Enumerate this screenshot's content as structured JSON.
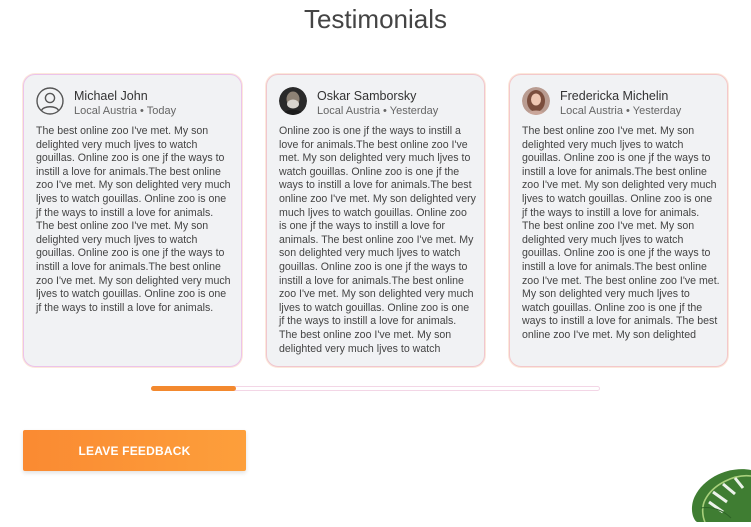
{
  "section": {
    "title": "Testimonials"
  },
  "testimonials": [
    {
      "name": "Michael John",
      "meta": "Local Austria • Today",
      "avatar": "user-outline-icon",
      "text": "The best online zoo I've met. My son delighted very much ljves to watch gouillas. Online zoo is one jf the ways to instill a love for animals.The best online zoo I've met. My son delighted very much ljves to watch gouillas. Online zoo is one jf the ways to instill a love for animals. The best online zoo I've met. My son delighted very much ljves to watch gouillas. Online zoo is one jf the ways to instill a love for animals.The best online zoo I've met. My son delighted very much ljves to watch gouillas. Online zoo is one jf the ways to instill a love for animals."
    },
    {
      "name": "Oskar Samborsky",
      "meta": "Local Austria • Yesterday",
      "avatar": "man-photo-avatar",
      "text": "Online zoo is one jf the ways to instill a love for animals.The best online zoo I've met. My son delighted very much ljves to watch gouillas. Online zoo is one jf the ways to instill a love for animals.The best online zoo I've met. My son delighted very much ljves to watch gouillas. Online zoo is one jf the ways to instill a love for animals. The best online zoo I've met. My son delighted very much ljves to watch gouillas. Online zoo is one jf the ways to instill a love for animals.The best online zoo I've met. My son delighted very much ljves to watch gouillas. Online zoo is one jf the ways to instill a love for animals. The best online zoo I've met. My son delighted very much ljves to watch"
    },
    {
      "name": "Fredericka Michelin",
      "meta": "Local Austria • Yesterday",
      "avatar": "woman-photo-avatar",
      "text": "The best online zoo I've met. My son delighted very much ljves to watch gouillas. Online zoo is one jf the ways to instill a love for animals.The best online zoo I've met. My son delighted very much ljves to watch gouillas. Online zoo is one jf the ways to instill a love for animals. The best online zoo I've met. My son delighted very much ljves to watch gouillas. Online zoo is one jf the ways to instill a love for animals.The best online zoo I've met. The best online zoo I've met. My son delighted very much ljves to watch gouillas. Online zoo is one jf the ways to instill a love for animals. The best online zoo I've met. My son delighted"
    }
  ],
  "slider": {
    "progress_fraction": 0.19,
    "accent_color": "#f3892e",
    "track_border_color": "#f3d6e6"
  },
  "feedback_button": {
    "label": "Leave feedback",
    "color": "#fa8a32"
  },
  "decoration": {
    "icon": "monstera-leaf-icon"
  }
}
